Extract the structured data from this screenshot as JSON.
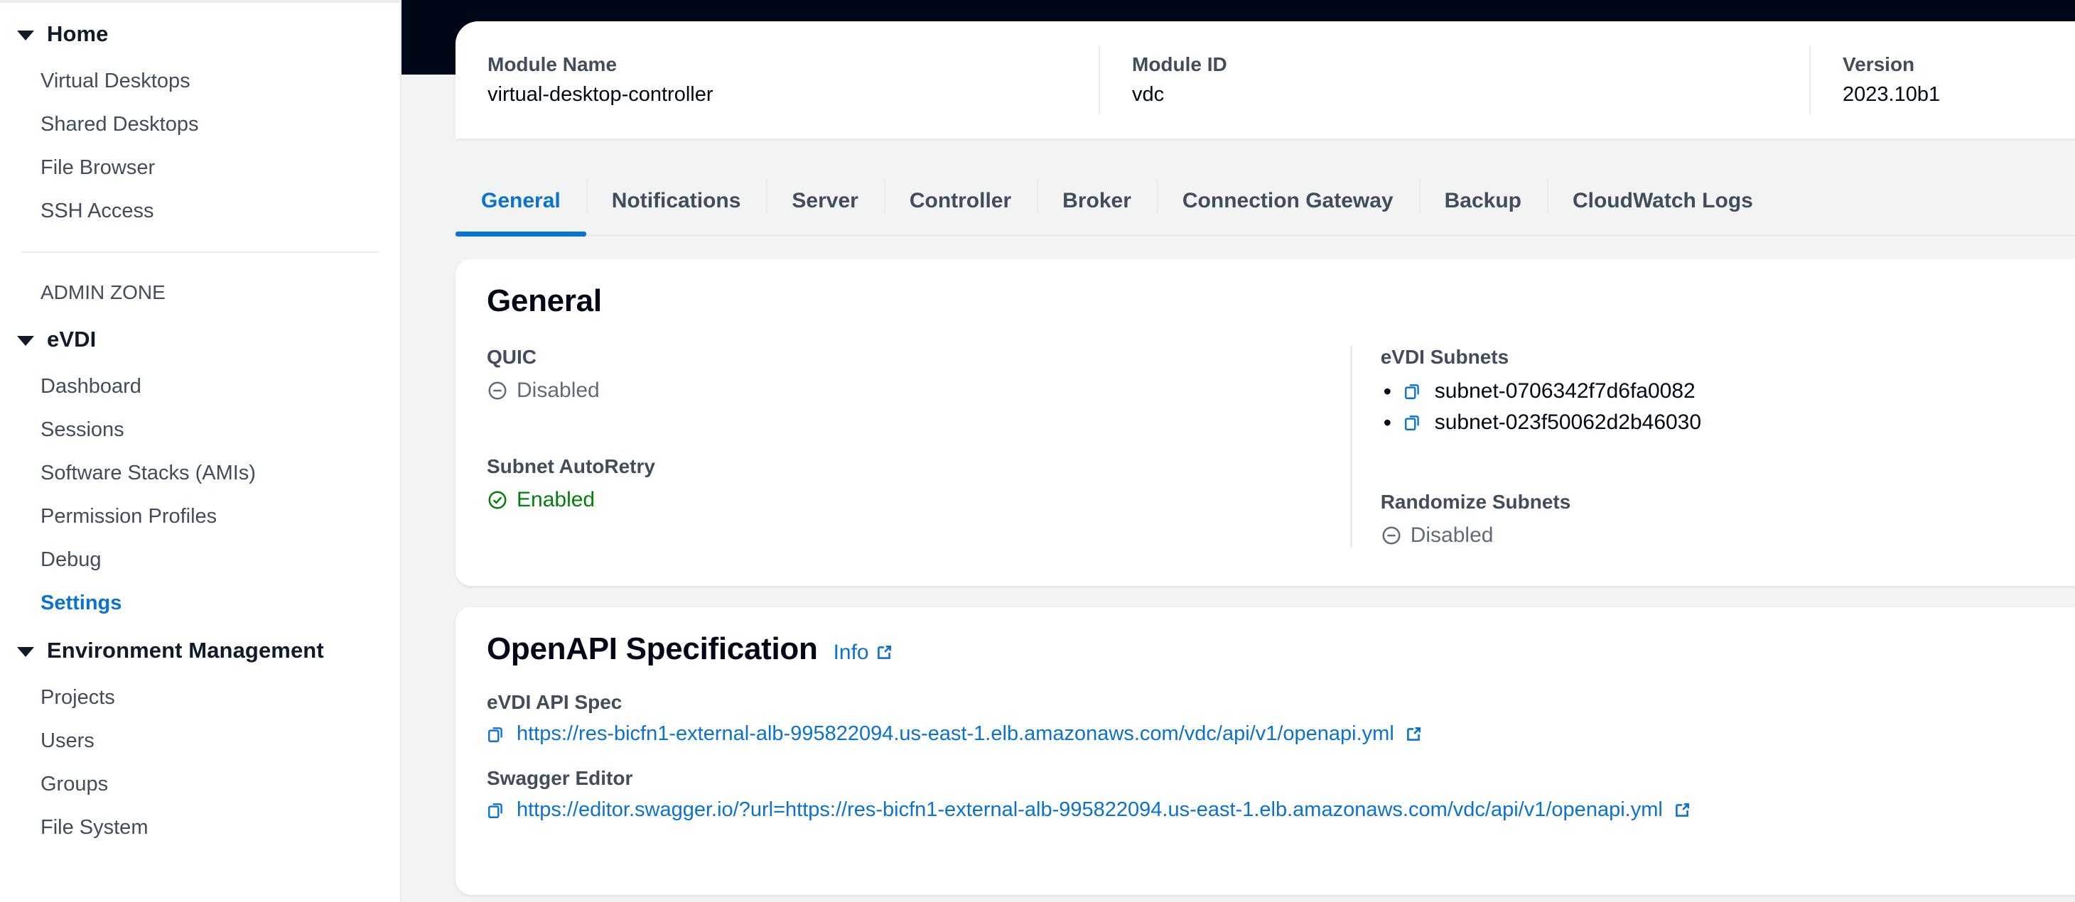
{
  "sidebar": {
    "groups": [
      {
        "title": "Home",
        "items": [
          {
            "label": "Virtual Desktops",
            "active": false
          },
          {
            "label": "Shared Desktops",
            "active": false
          },
          {
            "label": "File Browser",
            "active": false
          },
          {
            "label": "SSH Access",
            "active": false
          }
        ]
      }
    ],
    "section_label": "ADMIN ZONE",
    "group_evdi": {
      "title": "eVDI",
      "items": [
        {
          "label": "Dashboard",
          "active": false
        },
        {
          "label": "Sessions",
          "active": false
        },
        {
          "label": "Software Stacks (AMIs)",
          "active": false
        },
        {
          "label": "Permission Profiles",
          "active": false
        },
        {
          "label": "Debug",
          "active": false
        },
        {
          "label": "Settings",
          "active": true
        }
      ]
    },
    "group_env": {
      "title": "Environment Management",
      "items": [
        {
          "label": "Projects",
          "active": false
        },
        {
          "label": "Users",
          "active": false
        },
        {
          "label": "Groups",
          "active": false
        },
        {
          "label": "File System",
          "active": false
        }
      ]
    }
  },
  "header": {
    "module_name_label": "Module Name",
    "module_name_value": "virtual-desktop-controller",
    "module_id_label": "Module ID",
    "module_id_value": "vdc",
    "version_label": "Version",
    "version_value": "2023.10b1"
  },
  "tabs": [
    {
      "label": "General",
      "active": true
    },
    {
      "label": "Notifications",
      "active": false
    },
    {
      "label": "Server",
      "active": false
    },
    {
      "label": "Controller",
      "active": false
    },
    {
      "label": "Broker",
      "active": false
    },
    {
      "label": "Connection Gateway",
      "active": false
    },
    {
      "label": "Backup",
      "active": false
    },
    {
      "label": "CloudWatch Logs",
      "active": false
    }
  ],
  "general": {
    "title": "General",
    "quic": {
      "label": "QUIC",
      "value": "Disabled",
      "state": "disabled"
    },
    "subnet_autoretry": {
      "label": "Subnet AutoRetry",
      "value": "Enabled",
      "state": "enabled"
    },
    "evdi_subnets": {
      "label": "eVDI Subnets",
      "items": [
        "subnet-0706342f7d6fa0082",
        "subnet-023f50062d2b46030"
      ]
    },
    "randomize_subnets": {
      "label": "Randomize Subnets",
      "value": "Disabled",
      "state": "disabled"
    }
  },
  "openapi": {
    "title": "OpenAPI Specification",
    "info_label": "Info",
    "api_spec": {
      "label": "eVDI API Spec",
      "url": "https://res-bicfn1-external-alb-995822094.us-east-1.elb.amazonaws.com/vdc/api/v1/openapi.yml"
    },
    "swagger_editor": {
      "label": "Swagger Editor",
      "url": "https://editor.swagger.io/?url=https://res-bicfn1-external-alb-995822094.us-east-1.elb.amazonaws.com/vdc/api/v1/openapi.yml"
    }
  },
  "icons": {
    "copy": "copy-icon",
    "external": "external-link-icon",
    "status_disabled": "minus-circle-icon",
    "status_enabled": "check-circle-icon",
    "caret": "caret-down-icon"
  },
  "colors": {
    "accent": "#0972d3",
    "header_dark": "#000716",
    "success": "#037f0c",
    "muted": "#5f6b7a",
    "label": "#414d5c",
    "page_bg": "#f2f3f3",
    "divider": "#e9ebed"
  }
}
